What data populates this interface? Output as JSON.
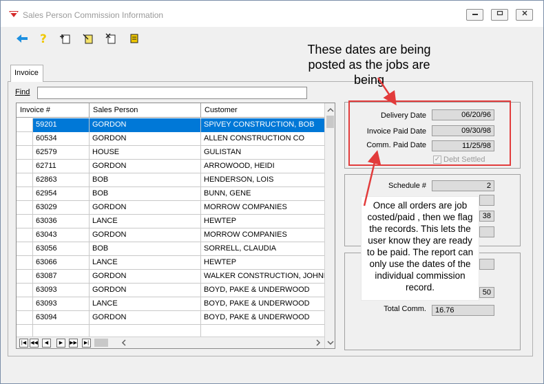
{
  "window": {
    "title": "Sales Person Commission Information",
    "controls": [
      "minimize",
      "restore",
      "close"
    ]
  },
  "toolbar": {
    "buttons": [
      {
        "icon": "back-arrow-icon"
      },
      {
        "icon": "help-icon"
      },
      {
        "icon": "new-record-icon"
      },
      {
        "icon": "edit-record-icon"
      },
      {
        "icon": "delete-record-icon"
      },
      {
        "icon": "note-icon"
      }
    ]
  },
  "tabs": [
    {
      "label": "Invoice",
      "active": true
    }
  ],
  "find": {
    "label": "Find",
    "value": ""
  },
  "grid": {
    "columns": [
      "Invoice #",
      "Sales Person",
      "Customer"
    ],
    "rows": [
      {
        "invoice": "59201",
        "sales_person": "GORDON",
        "customer": "SPIVEY CONSTRUCTION, BOB",
        "selected": true
      },
      {
        "invoice": "60534",
        "sales_person": "GORDON",
        "customer": "ALLEN CONSTRUCTION CO"
      },
      {
        "invoice": "62579",
        "sales_person": "HOUSE",
        "customer": "GULISTAN"
      },
      {
        "invoice": "62711",
        "sales_person": "GORDON",
        "customer": "ARROWOOD, HEIDI"
      },
      {
        "invoice": "62863",
        "sales_person": "BOB",
        "customer": "HENDERSON, LOIS"
      },
      {
        "invoice": "62954",
        "sales_person": "BOB",
        "customer": "BUNN, GENE"
      },
      {
        "invoice": "63029",
        "sales_person": "GORDON",
        "customer": "MORROW COMPANIES"
      },
      {
        "invoice": "63036",
        "sales_person": "LANCE",
        "customer": "HEWTEP"
      },
      {
        "invoice": "63043",
        "sales_person": "GORDON",
        "customer": "MORROW COMPANIES"
      },
      {
        "invoice": "63056",
        "sales_person": "BOB",
        "customer": "SORRELL, CLAUDIA"
      },
      {
        "invoice": "63066",
        "sales_person": "LANCE",
        "customer": "HEWTEP"
      },
      {
        "invoice": "63087",
        "sales_person": "GORDON",
        "customer": "WALKER CONSTRUCTION, JOHNNY"
      },
      {
        "invoice": "63093",
        "sales_person": "GORDON",
        "customer": "BOYD, PAKE & UNDERWOOD"
      },
      {
        "invoice": "63093",
        "sales_person": "LANCE",
        "customer": "BOYD, PAKE & UNDERWOOD"
      },
      {
        "invoice": "63094",
        "sales_person": "GORDON",
        "customer": "BOYD, PAKE & UNDERWOOD"
      }
    ],
    "nav_buttons": [
      "|◀",
      "◀◀",
      "◀",
      "▶",
      "▶▶",
      "▶|"
    ]
  },
  "dates": {
    "delivery_label": "Delivery Date",
    "delivery_value": "06/20/96",
    "invoice_paid_label": "Invoice Paid Date",
    "invoice_paid_value": "09/30/98",
    "comm_paid_label": "Comm. Paid Date",
    "comm_paid_value": "11/25/98",
    "debt_settled_label": "Debt Settled",
    "debt_settled_checked": true
  },
  "schedule": {
    "label": "Schedule #",
    "value": "2",
    "partial_value_3": "38",
    "partial_value_5": "50"
  },
  "totals": {
    "total_comm_label": "Total Comm.",
    "total_comm_value": "16.76"
  },
  "annotations": {
    "top": "These dates are being posted as the jobs are being",
    "box": "Once all orders are job costed/paid , then we flag the records.  This lets the user know they are ready to be paid.  The report can only use the dates of the individual commission record."
  },
  "colors": {
    "selection": "#0078d7",
    "annotation_red": "#e23b3b",
    "toolbar_blue": "#1e90e0",
    "toolbar_yellow": "#f0c800"
  }
}
